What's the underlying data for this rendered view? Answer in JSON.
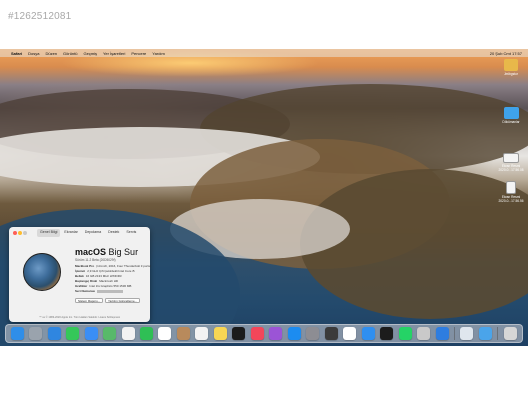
{
  "stock_id": "#1262512081",
  "menubar": {
    "apple_glyph": "",
    "app_name": "Safari",
    "items": [
      "Dosya",
      "Düzen",
      "Görüntü",
      "Geçmiş",
      "Yer İşaretleri",
      "Pencere",
      "Yardım"
    ],
    "clock": "20 Şub Cmt 17:57"
  },
  "desktop_icons": [
    {
      "name": "drive-icon",
      "label": "Jmlbgstur",
      "color": "#e8b84a"
    },
    {
      "name": "folder-icon",
      "label": "Dökümanlar",
      "color": "#3fa2ea"
    },
    {
      "name": "screenshot-icon",
      "label": "Ekran Resmi 2020-0...17.56.08",
      "color": "#f4f4f4"
    },
    {
      "name": "screenshot-icon",
      "label": "Ekran Resmi 2020-0...17.56.56",
      "color": "#f4f4f4"
    }
  ],
  "about": {
    "tabs": [
      "Genel Bilgi",
      "Ekranlar",
      "Depolama",
      "Destek",
      "Servis"
    ],
    "title_bold": "macOS",
    "title_light": "Big Sur",
    "version": "Sürüm 11.2 Beta (20D5029f)",
    "specs": [
      {
        "label": "MacBook Pro",
        "value": "(13-inch, 2016, Four Thunderbolt 3 ports)"
      },
      {
        "label": "İşlemci",
        "value": "2,9 GHz Çift Çekirdekli Intel Core i5"
      },
      {
        "label": "Bellek",
        "value": "16 GB 2133 MHz LPDDR3"
      },
      {
        "label": "Başlangıç Diski",
        "value": "Macintosh HD"
      },
      {
        "label": "Grafikler",
        "value": "Intel Iris Graphics 550 1536 MB"
      },
      {
        "label": "Seri Numarası",
        "value": ""
      }
    ],
    "buttons": [
      "Sistem Raporu...",
      "Yazılım Güncelleme..."
    ],
    "footer": "™ ve © 1983-2020 Apple Inc. Tüm Hakları Saklıdır. Lisans Sözleşmesi"
  },
  "dock_apps": [
    {
      "name": "finder-icon",
      "color": "#2f8ee8"
    },
    {
      "name": "launchpad-icon",
      "color": "#9aa3ad"
    },
    {
      "name": "safari-icon",
      "color": "#2f86e0"
    },
    {
      "name": "messages-icon",
      "color": "#35c759"
    },
    {
      "name": "mail-icon",
      "color": "#3a8ef5"
    },
    {
      "name": "maps-icon",
      "color": "#58b96a"
    },
    {
      "name": "photos-icon",
      "color": "#f2f2f2"
    },
    {
      "name": "facetime-icon",
      "color": "#2fbf55"
    },
    {
      "name": "calendar-icon",
      "color": "#ffffff"
    },
    {
      "name": "contacts-icon",
      "color": "#b88a5c"
    },
    {
      "name": "reminders-icon",
      "color": "#f3f3f3"
    },
    {
      "name": "notes-icon",
      "color": "#f7d654"
    },
    {
      "name": "tv-icon",
      "color": "#1b1b1b"
    },
    {
      "name": "music-icon",
      "color": "#f3465a"
    },
    {
      "name": "podcasts-icon",
      "color": "#9b54d6"
    },
    {
      "name": "app-store-icon",
      "color": "#1c8cf0"
    },
    {
      "name": "system-preferences-icon",
      "color": "#8d8d93"
    },
    {
      "name": "activity-monitor-icon",
      "color": "#3b3b3b"
    },
    {
      "name": "vlc-icon",
      "color": "#ffffff"
    },
    {
      "name": "keynote-icon",
      "color": "#2f8ff0"
    },
    {
      "name": "terminal-icon",
      "color": "#1c1c1c"
    },
    {
      "name": "whatsapp-icon",
      "color": "#25d366"
    },
    {
      "name": "utilities-icon",
      "color": "#c9c9c9"
    },
    {
      "name": "xcode-icon",
      "color": "#2e7de0"
    },
    {
      "name": "preview-icon",
      "color": "#dfe6ee"
    },
    {
      "name": "downloads-folder-icon",
      "color": "#4aa4ea"
    },
    {
      "name": "trash-icon",
      "color": "#d6d6d6"
    }
  ]
}
